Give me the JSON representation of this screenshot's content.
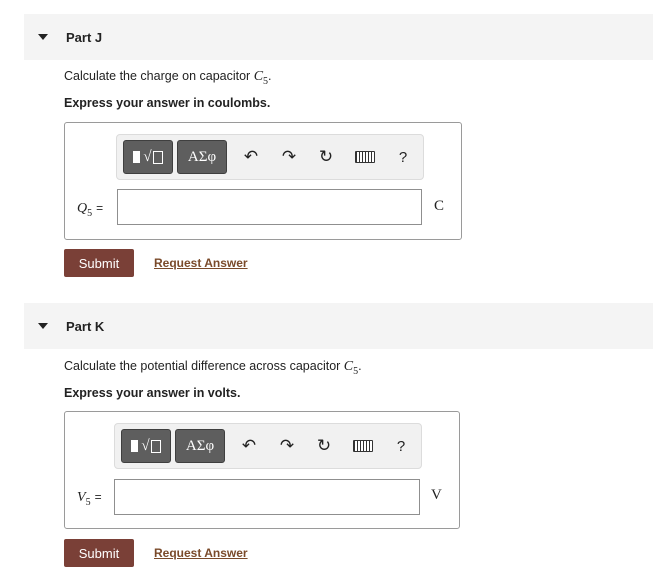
{
  "parts": [
    {
      "title": "Part J",
      "question_prefix": "Calculate the charge on capacitor ",
      "question_var": "C",
      "question_sub": "5",
      "question_suffix": ".",
      "instruction": "Express your answer in coulombs.",
      "answer_var": "Q",
      "answer_sub": "5",
      "answer_eq": "=",
      "answer_value": "",
      "unit": "C",
      "submit_label": "Submit",
      "request_label": "Request Answer"
    },
    {
      "title": "Part K",
      "question_prefix": "Calculate the potential difference across capacitor ",
      "question_var": "C",
      "question_sub": "5",
      "question_suffix": ".",
      "instruction": "Express your answer in volts.",
      "answer_var": "V",
      "answer_sub": "5",
      "answer_eq": "=",
      "answer_value": "",
      "unit": "V",
      "submit_label": "Submit",
      "request_label": "Request Answer"
    }
  ],
  "toolbar": {
    "symbols_label": "ΑΣφ",
    "radical_glyph": "√",
    "help_label": "?",
    "icons": [
      "templates-icon",
      "symbols-icon",
      "undo-icon",
      "redo-icon",
      "reset-icon",
      "keyboard-icon",
      "help-icon"
    ]
  },
  "colors": {
    "submit_bg": "#7a4037",
    "link": "#7a4a2a",
    "header_bg": "#f4f4f4",
    "toolbar_btn": "#5e5e5e"
  }
}
